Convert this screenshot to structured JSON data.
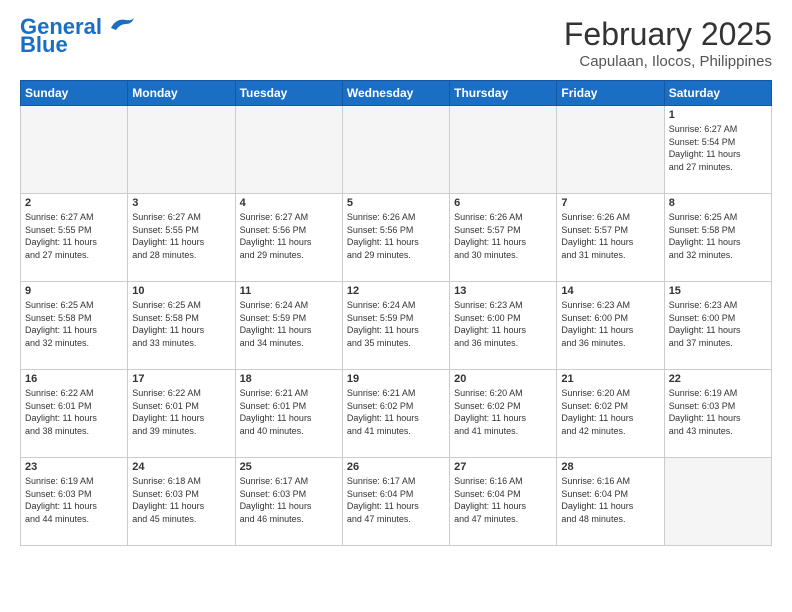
{
  "header": {
    "logo_line1": "General",
    "logo_line2": "Blue",
    "month": "February 2025",
    "location": "Capulaan, Ilocos, Philippines"
  },
  "days_of_week": [
    "Sunday",
    "Monday",
    "Tuesday",
    "Wednesday",
    "Thursday",
    "Friday",
    "Saturday"
  ],
  "weeks": [
    [
      {
        "day": "",
        "info": ""
      },
      {
        "day": "",
        "info": ""
      },
      {
        "day": "",
        "info": ""
      },
      {
        "day": "",
        "info": ""
      },
      {
        "day": "",
        "info": ""
      },
      {
        "day": "",
        "info": ""
      },
      {
        "day": "1",
        "info": "Sunrise: 6:27 AM\nSunset: 5:54 PM\nDaylight: 11 hours\nand 27 minutes."
      }
    ],
    [
      {
        "day": "2",
        "info": "Sunrise: 6:27 AM\nSunset: 5:55 PM\nDaylight: 11 hours\nand 27 minutes."
      },
      {
        "day": "3",
        "info": "Sunrise: 6:27 AM\nSunset: 5:55 PM\nDaylight: 11 hours\nand 28 minutes."
      },
      {
        "day": "4",
        "info": "Sunrise: 6:27 AM\nSunset: 5:56 PM\nDaylight: 11 hours\nand 29 minutes."
      },
      {
        "day": "5",
        "info": "Sunrise: 6:26 AM\nSunset: 5:56 PM\nDaylight: 11 hours\nand 29 minutes."
      },
      {
        "day": "6",
        "info": "Sunrise: 6:26 AM\nSunset: 5:57 PM\nDaylight: 11 hours\nand 30 minutes."
      },
      {
        "day": "7",
        "info": "Sunrise: 6:26 AM\nSunset: 5:57 PM\nDaylight: 11 hours\nand 31 minutes."
      },
      {
        "day": "8",
        "info": "Sunrise: 6:25 AM\nSunset: 5:58 PM\nDaylight: 11 hours\nand 32 minutes."
      }
    ],
    [
      {
        "day": "9",
        "info": "Sunrise: 6:25 AM\nSunset: 5:58 PM\nDaylight: 11 hours\nand 32 minutes."
      },
      {
        "day": "10",
        "info": "Sunrise: 6:25 AM\nSunset: 5:58 PM\nDaylight: 11 hours\nand 33 minutes."
      },
      {
        "day": "11",
        "info": "Sunrise: 6:24 AM\nSunset: 5:59 PM\nDaylight: 11 hours\nand 34 minutes."
      },
      {
        "day": "12",
        "info": "Sunrise: 6:24 AM\nSunset: 5:59 PM\nDaylight: 11 hours\nand 35 minutes."
      },
      {
        "day": "13",
        "info": "Sunrise: 6:23 AM\nSunset: 6:00 PM\nDaylight: 11 hours\nand 36 minutes."
      },
      {
        "day": "14",
        "info": "Sunrise: 6:23 AM\nSunset: 6:00 PM\nDaylight: 11 hours\nand 36 minutes."
      },
      {
        "day": "15",
        "info": "Sunrise: 6:23 AM\nSunset: 6:00 PM\nDaylight: 11 hours\nand 37 minutes."
      }
    ],
    [
      {
        "day": "16",
        "info": "Sunrise: 6:22 AM\nSunset: 6:01 PM\nDaylight: 11 hours\nand 38 minutes."
      },
      {
        "day": "17",
        "info": "Sunrise: 6:22 AM\nSunset: 6:01 PM\nDaylight: 11 hours\nand 39 minutes."
      },
      {
        "day": "18",
        "info": "Sunrise: 6:21 AM\nSunset: 6:01 PM\nDaylight: 11 hours\nand 40 minutes."
      },
      {
        "day": "19",
        "info": "Sunrise: 6:21 AM\nSunset: 6:02 PM\nDaylight: 11 hours\nand 41 minutes."
      },
      {
        "day": "20",
        "info": "Sunrise: 6:20 AM\nSunset: 6:02 PM\nDaylight: 11 hours\nand 41 minutes."
      },
      {
        "day": "21",
        "info": "Sunrise: 6:20 AM\nSunset: 6:02 PM\nDaylight: 11 hours\nand 42 minutes."
      },
      {
        "day": "22",
        "info": "Sunrise: 6:19 AM\nSunset: 6:03 PM\nDaylight: 11 hours\nand 43 minutes."
      }
    ],
    [
      {
        "day": "23",
        "info": "Sunrise: 6:19 AM\nSunset: 6:03 PM\nDaylight: 11 hours\nand 44 minutes."
      },
      {
        "day": "24",
        "info": "Sunrise: 6:18 AM\nSunset: 6:03 PM\nDaylight: 11 hours\nand 45 minutes."
      },
      {
        "day": "25",
        "info": "Sunrise: 6:17 AM\nSunset: 6:03 PM\nDaylight: 11 hours\nand 46 minutes."
      },
      {
        "day": "26",
        "info": "Sunrise: 6:17 AM\nSunset: 6:04 PM\nDaylight: 11 hours\nand 47 minutes."
      },
      {
        "day": "27",
        "info": "Sunrise: 6:16 AM\nSunset: 6:04 PM\nDaylight: 11 hours\nand 47 minutes."
      },
      {
        "day": "28",
        "info": "Sunrise: 6:16 AM\nSunset: 6:04 PM\nDaylight: 11 hours\nand 48 minutes."
      },
      {
        "day": "",
        "info": ""
      }
    ]
  ]
}
